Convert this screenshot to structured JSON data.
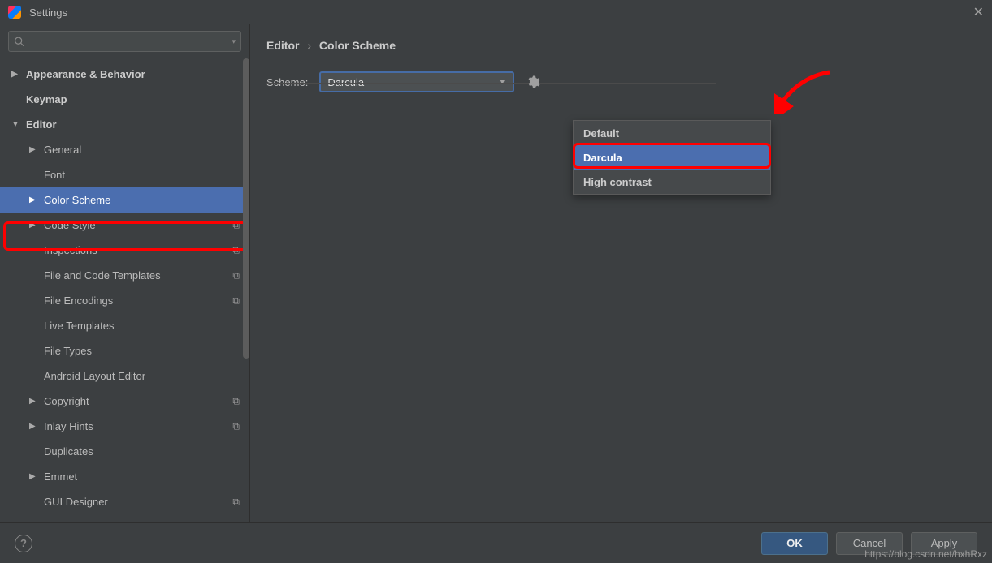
{
  "window": {
    "title": "Settings"
  },
  "breadcrumb": {
    "root": "Editor",
    "sep": "›",
    "leaf": "Color Scheme"
  },
  "scheme": {
    "label": "Scheme:",
    "selected": "Darcula",
    "options": [
      "Default",
      "Darcula",
      "High contrast"
    ]
  },
  "sidebar": {
    "search_placeholder": "",
    "items": [
      {
        "label": "Appearance & Behavior",
        "arrow": "▶",
        "bold": true,
        "lvl": 0
      },
      {
        "label": "Keymap",
        "arrow": "",
        "bold": true,
        "lvl": 0
      },
      {
        "label": "Editor",
        "arrow": "▼",
        "bold": true,
        "lvl": 0
      },
      {
        "label": "General",
        "arrow": "▶",
        "bold": false,
        "lvl": 1
      },
      {
        "label": "Font",
        "arrow": "",
        "bold": false,
        "lvl": 1
      },
      {
        "label": "Color Scheme",
        "arrow": "▶",
        "bold": false,
        "lvl": 1,
        "selected": true
      },
      {
        "label": "Code Style",
        "arrow": "▶",
        "bold": false,
        "lvl": 1,
        "proj": true
      },
      {
        "label": "Inspections",
        "arrow": "",
        "bold": false,
        "lvl": 1,
        "proj": true
      },
      {
        "label": "File and Code Templates",
        "arrow": "",
        "bold": false,
        "lvl": 1,
        "proj": true
      },
      {
        "label": "File Encodings",
        "arrow": "",
        "bold": false,
        "lvl": 1,
        "proj": true
      },
      {
        "label": "Live Templates",
        "arrow": "",
        "bold": false,
        "lvl": 1
      },
      {
        "label": "File Types",
        "arrow": "",
        "bold": false,
        "lvl": 1
      },
      {
        "label": "Android Layout Editor",
        "arrow": "",
        "bold": false,
        "lvl": 1
      },
      {
        "label": "Copyright",
        "arrow": "▶",
        "bold": false,
        "lvl": 1,
        "proj": true
      },
      {
        "label": "Inlay Hints",
        "arrow": "▶",
        "bold": false,
        "lvl": 1,
        "proj": true
      },
      {
        "label": "Duplicates",
        "arrow": "",
        "bold": false,
        "lvl": 1
      },
      {
        "label": "Emmet",
        "arrow": "▶",
        "bold": false,
        "lvl": 1
      },
      {
        "label": "GUI Designer",
        "arrow": "",
        "bold": false,
        "lvl": 1,
        "proj": true
      }
    ]
  },
  "footer": {
    "ok": "OK",
    "cancel": "Cancel",
    "apply": "Apply"
  },
  "watermark": "https://blog.csdn.net/hxhRxz"
}
